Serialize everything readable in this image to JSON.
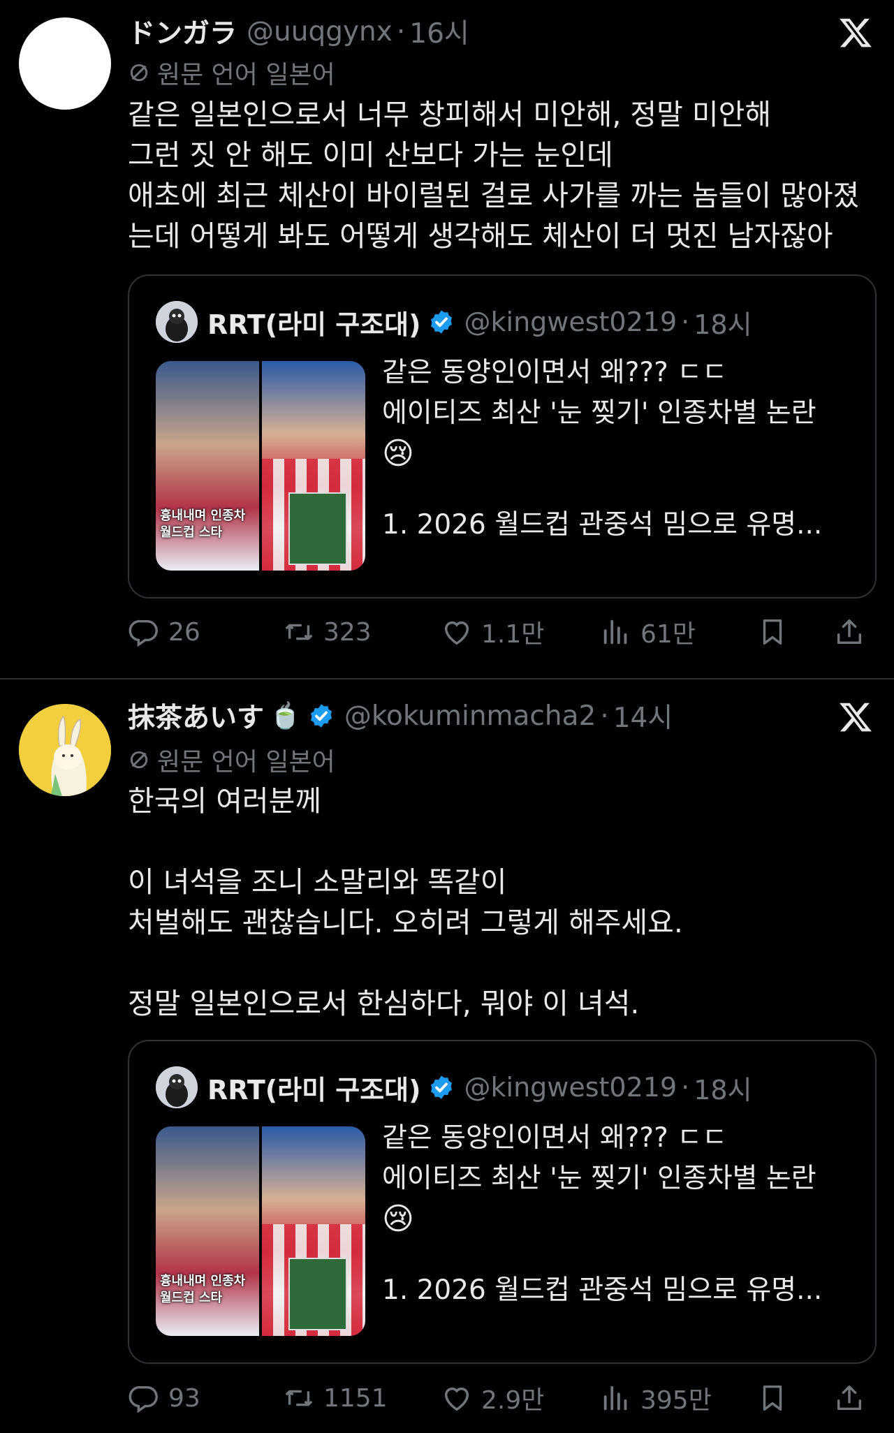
{
  "tweets": [
    {
      "author_name": "ドンガラ",
      "handle": "@uuqgynx",
      "separator": "·",
      "time": "16시",
      "translate_label": "원문 언어 일본어",
      "body_lines": [
        "같은 일본인으로서 너무 창피해서 미안해, 정말 미안해",
        "그런 짓 안 해도 이미 산보다 가는 눈인데",
        "애초에 최근 체산이 바이럴된 걸로 사가를 까는 놈들이 많아졌",
        "는데 어떻게 봐도 어떻게 생각해도 체산이 더 멋진 남자잖아"
      ],
      "quote": {
        "author_name": "RRT(라미 구조대)",
        "handle": "@kingwest0219",
        "separator": "·",
        "time": "18시",
        "thumb_caption_1": "흉내내며 인종차",
        "thumb_caption_2": "월드컵 스타",
        "line1": "같은 동양인이면서 왜??? ㄷㄷ",
        "line2": "에이티즈 최산 '눈 찢기' 인종차별 논란",
        "emoji": "😢",
        "summary": "1. 2026 월드컵 관중석 밈으로 유명..."
      },
      "stats": {
        "replies": "26",
        "retweets": "323",
        "likes": "1.1만",
        "views": "61만"
      }
    },
    {
      "author_name": "抹茶あいす",
      "name_emoji": "🍵",
      "handle": "@kokuminmacha2",
      "separator": "·",
      "time": "14시",
      "translate_label": "원문 언어 일본어",
      "body_lines": [
        "한국의 여러분께",
        "",
        "이 녀석을 조니 소말리와 똑같이",
        "처벌해도 괜찮습니다. 오히려 그렇게 해주세요.",
        "",
        "정말 일본인으로서 한심하다, 뭐야 이 녀석."
      ],
      "quote": {
        "author_name": "RRT(라미 구조대)",
        "handle": "@kingwest0219",
        "separator": "·",
        "time": "18시",
        "thumb_caption_1": "흉내내며 인종차",
        "thumb_caption_2": "월드컵 스타",
        "line1": "같은 동양인이면서 왜??? ㄷㄷ",
        "line2": "에이티즈 최산 '눈 찢기' 인종차별 논란",
        "emoji": "😢",
        "summary": "1. 2026 월드컵 관중석 밈으로 유명..."
      },
      "stats": {
        "replies": "93",
        "retweets": "1151",
        "likes": "2.9만",
        "views": "395만"
      }
    }
  ],
  "colors": {
    "background": "#000000",
    "text": "#e7e9ea",
    "muted": "#71767b",
    "verified": "#1d9bf0",
    "border": "#2f3336"
  },
  "icons": [
    "x-logo-icon",
    "translate-icon",
    "verified-icon",
    "reply-icon",
    "retweet-icon",
    "like-icon",
    "views-icon",
    "bookmark-icon",
    "share-icon"
  ]
}
